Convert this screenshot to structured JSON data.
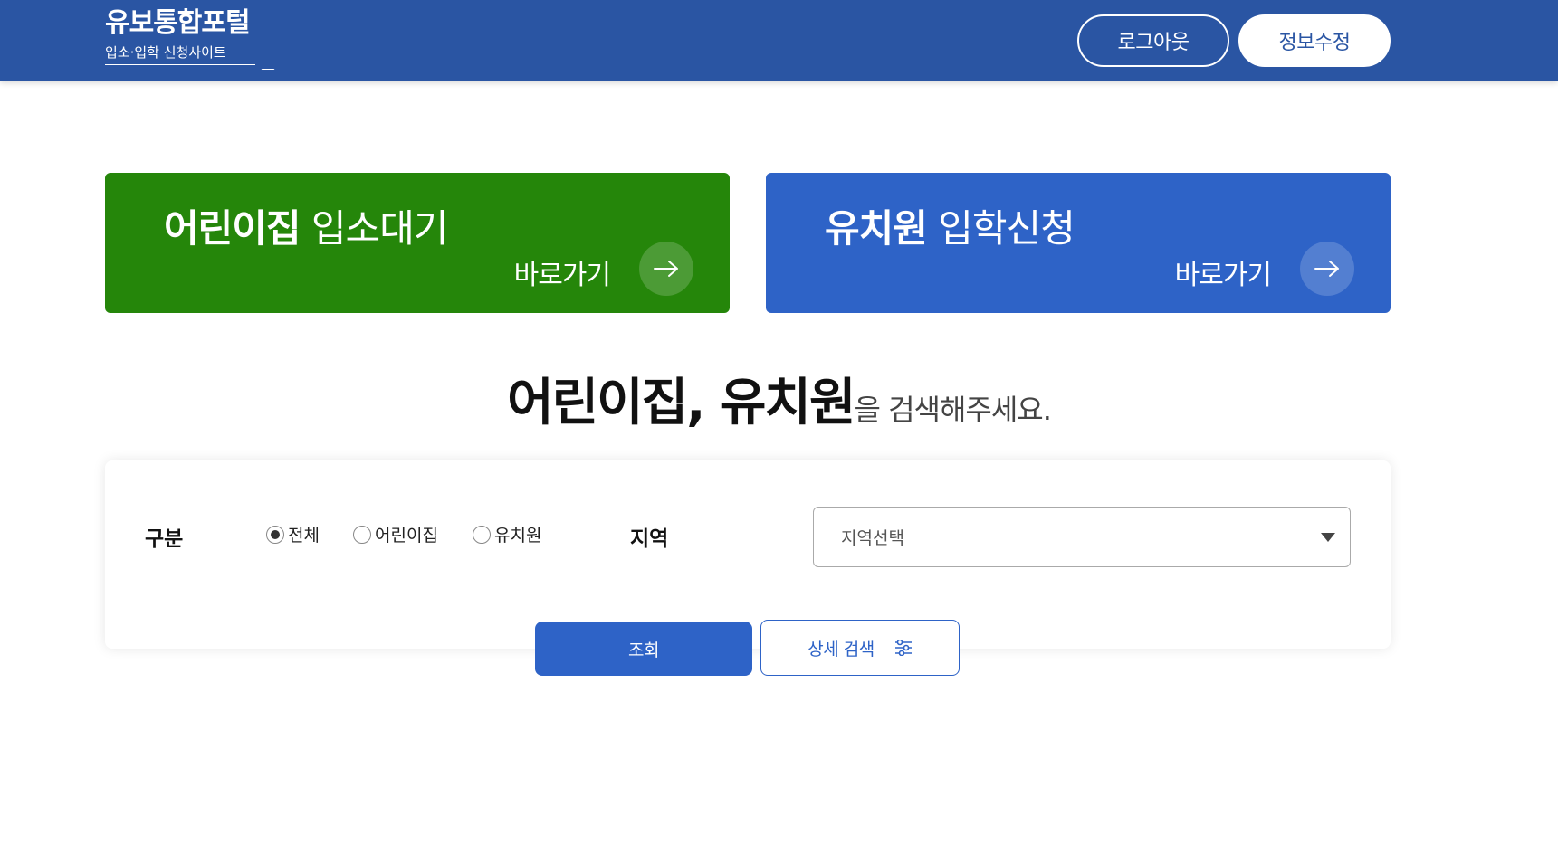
{
  "header": {
    "brand_title": "유보통합포털",
    "brand_subtitle": "입소·입학 신청사이트",
    "logout_label": "로그아웃",
    "edit_info_label": "정보수정",
    "bg_color": "#2a55a3"
  },
  "shortcuts": [
    {
      "title_bold": "어린이집",
      "title_light": "입소대기",
      "link_label": "바로가기",
      "color": "#25860a"
    },
    {
      "title_bold": "유치원",
      "title_light": "입학신청",
      "link_label": "바로가기",
      "color": "#2e63c7"
    }
  ],
  "search": {
    "heading_strong": "어린이집, 유치원",
    "heading_rest": "을 검색해주세요.",
    "type_label": "구분",
    "type_options": [
      "전체",
      "어린이집",
      "유치원"
    ],
    "type_selected": "전체",
    "region_label": "지역",
    "region_placeholder": "지역선택",
    "search_button": "조회",
    "detail_button": "상세 검색"
  },
  "icons": {
    "arrow": "arrow-right-icon",
    "caret": "caret-down-icon",
    "filter": "sliders-icon"
  }
}
